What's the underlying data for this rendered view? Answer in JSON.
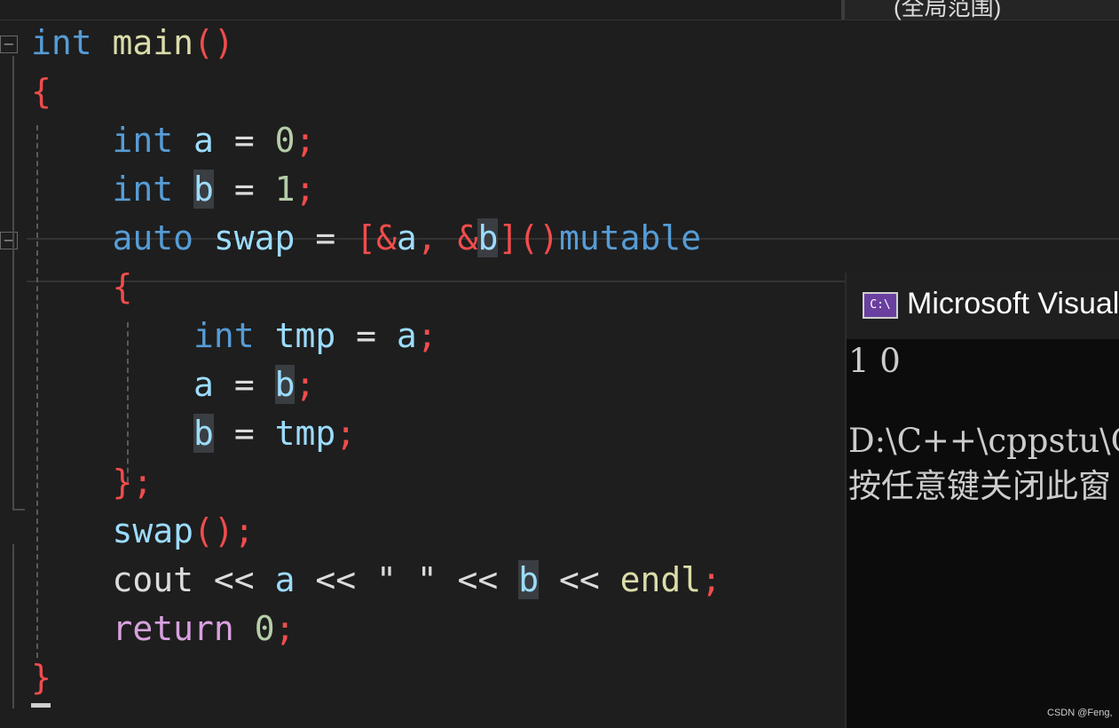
{
  "scope_dropdown": {
    "label": "(全局范围)"
  },
  "code": {
    "l1": [
      "int",
      "main",
      "()"
    ],
    "l2": [
      "{"
    ],
    "l3": [
      "int",
      "a",
      "=",
      "0",
      ";"
    ],
    "l4": [
      "int",
      "b",
      "=",
      "1",
      ";"
    ],
    "l5": [
      "auto",
      "swap",
      "=",
      "[",
      "&",
      "a",
      ",",
      "&",
      "b",
      "]",
      "()",
      "mutable"
    ],
    "l6": [
      "{"
    ],
    "l7": [
      "int",
      "tmp",
      "=",
      "a",
      ";"
    ],
    "l8": [
      "a",
      "=",
      "b",
      ";"
    ],
    "l9": [
      "b",
      "=",
      "tmp",
      ";"
    ],
    "l10": [
      "}",
      ";"
    ],
    "l11": [
      "swap",
      "()",
      ";"
    ],
    "l12": [
      "cout",
      "<<",
      "a",
      "<<",
      "\" \"",
      "<<",
      "b",
      "<<",
      "endl",
      ";"
    ],
    "l13": [
      "return",
      "0",
      ";"
    ],
    "l14": [
      "}"
    ]
  },
  "fold_markers": {
    "symbol": "−"
  },
  "console": {
    "icon_text": "C:\\",
    "title": "Microsoft Visual",
    "lines": [
      "1 0",
      "",
      "D:\\C++\\cppstu\\C",
      "按任意键关闭此窗"
    ]
  },
  "watermark": "CSDN @Feng,",
  "colors": {
    "keyword": "#569cd6",
    "function": "#dcdcaa",
    "variable": "#9cdcfe",
    "number": "#b5cea8",
    "punctuation": "#f14c4c",
    "control": "#d8a0df"
  }
}
